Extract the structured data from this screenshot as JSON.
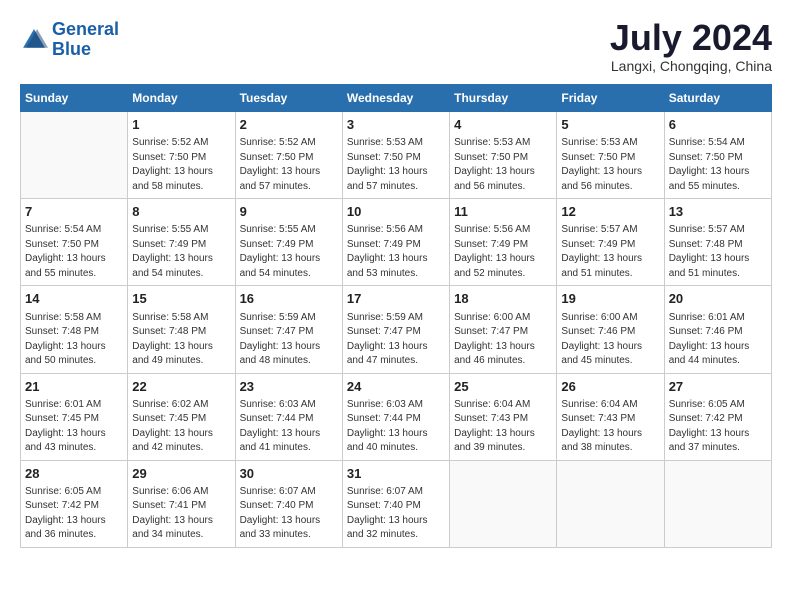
{
  "header": {
    "logo_line1": "General",
    "logo_line2": "Blue",
    "month_year": "July 2024",
    "location": "Langxi, Chongqing, China"
  },
  "weekdays": [
    "Sunday",
    "Monday",
    "Tuesday",
    "Wednesday",
    "Thursday",
    "Friday",
    "Saturday"
  ],
  "weeks": [
    [
      {
        "day": "",
        "empty": true
      },
      {
        "day": "1",
        "sunrise": "5:52 AM",
        "sunset": "7:50 PM",
        "daylight": "13 hours and 58 minutes."
      },
      {
        "day": "2",
        "sunrise": "5:52 AM",
        "sunset": "7:50 PM",
        "daylight": "13 hours and 57 minutes."
      },
      {
        "day": "3",
        "sunrise": "5:53 AM",
        "sunset": "7:50 PM",
        "daylight": "13 hours and 57 minutes."
      },
      {
        "day": "4",
        "sunrise": "5:53 AM",
        "sunset": "7:50 PM",
        "daylight": "13 hours and 56 minutes."
      },
      {
        "day": "5",
        "sunrise": "5:53 AM",
        "sunset": "7:50 PM",
        "daylight": "13 hours and 56 minutes."
      },
      {
        "day": "6",
        "sunrise": "5:54 AM",
        "sunset": "7:50 PM",
        "daylight": "13 hours and 55 minutes."
      }
    ],
    [
      {
        "day": "7",
        "sunrise": "5:54 AM",
        "sunset": "7:50 PM",
        "daylight": "13 hours and 55 minutes."
      },
      {
        "day": "8",
        "sunrise": "5:55 AM",
        "sunset": "7:49 PM",
        "daylight": "13 hours and 54 minutes."
      },
      {
        "day": "9",
        "sunrise": "5:55 AM",
        "sunset": "7:49 PM",
        "daylight": "13 hours and 54 minutes."
      },
      {
        "day": "10",
        "sunrise": "5:56 AM",
        "sunset": "7:49 PM",
        "daylight": "13 hours and 53 minutes."
      },
      {
        "day": "11",
        "sunrise": "5:56 AM",
        "sunset": "7:49 PM",
        "daylight": "13 hours and 52 minutes."
      },
      {
        "day": "12",
        "sunrise": "5:57 AM",
        "sunset": "7:49 PM",
        "daylight": "13 hours and 51 minutes."
      },
      {
        "day": "13",
        "sunrise": "5:57 AM",
        "sunset": "7:48 PM",
        "daylight": "13 hours and 51 minutes."
      }
    ],
    [
      {
        "day": "14",
        "sunrise": "5:58 AM",
        "sunset": "7:48 PM",
        "daylight": "13 hours and 50 minutes."
      },
      {
        "day": "15",
        "sunrise": "5:58 AM",
        "sunset": "7:48 PM",
        "daylight": "13 hours and 49 minutes."
      },
      {
        "day": "16",
        "sunrise": "5:59 AM",
        "sunset": "7:47 PM",
        "daylight": "13 hours and 48 minutes."
      },
      {
        "day": "17",
        "sunrise": "5:59 AM",
        "sunset": "7:47 PM",
        "daylight": "13 hours and 47 minutes."
      },
      {
        "day": "18",
        "sunrise": "6:00 AM",
        "sunset": "7:47 PM",
        "daylight": "13 hours and 46 minutes."
      },
      {
        "day": "19",
        "sunrise": "6:00 AM",
        "sunset": "7:46 PM",
        "daylight": "13 hours and 45 minutes."
      },
      {
        "day": "20",
        "sunrise": "6:01 AM",
        "sunset": "7:46 PM",
        "daylight": "13 hours and 44 minutes."
      }
    ],
    [
      {
        "day": "21",
        "sunrise": "6:01 AM",
        "sunset": "7:45 PM",
        "daylight": "13 hours and 43 minutes."
      },
      {
        "day": "22",
        "sunrise": "6:02 AM",
        "sunset": "7:45 PM",
        "daylight": "13 hours and 42 minutes."
      },
      {
        "day": "23",
        "sunrise": "6:03 AM",
        "sunset": "7:44 PM",
        "daylight": "13 hours and 41 minutes."
      },
      {
        "day": "24",
        "sunrise": "6:03 AM",
        "sunset": "7:44 PM",
        "daylight": "13 hours and 40 minutes."
      },
      {
        "day": "25",
        "sunrise": "6:04 AM",
        "sunset": "7:43 PM",
        "daylight": "13 hours and 39 minutes."
      },
      {
        "day": "26",
        "sunrise": "6:04 AM",
        "sunset": "7:43 PM",
        "daylight": "13 hours and 38 minutes."
      },
      {
        "day": "27",
        "sunrise": "6:05 AM",
        "sunset": "7:42 PM",
        "daylight": "13 hours and 37 minutes."
      }
    ],
    [
      {
        "day": "28",
        "sunrise": "6:05 AM",
        "sunset": "7:42 PM",
        "daylight": "13 hours and 36 minutes."
      },
      {
        "day": "29",
        "sunrise": "6:06 AM",
        "sunset": "7:41 PM",
        "daylight": "13 hours and 34 minutes."
      },
      {
        "day": "30",
        "sunrise": "6:07 AM",
        "sunset": "7:40 PM",
        "daylight": "13 hours and 33 minutes."
      },
      {
        "day": "31",
        "sunrise": "6:07 AM",
        "sunset": "7:40 PM",
        "daylight": "13 hours and 32 minutes."
      },
      {
        "day": "",
        "empty": true
      },
      {
        "day": "",
        "empty": true
      },
      {
        "day": "",
        "empty": true
      }
    ]
  ]
}
